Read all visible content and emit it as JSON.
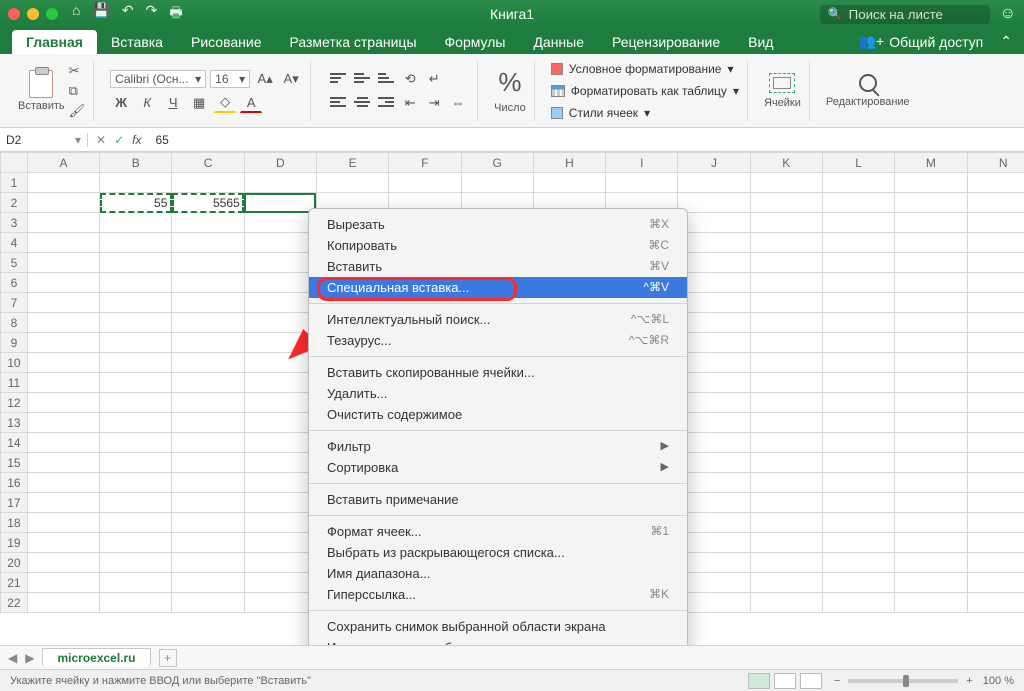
{
  "title": "Книга1",
  "search_placeholder": "Поиск на листе",
  "tabs": {
    "home": "Главная",
    "insert": "Вставка",
    "draw": "Рисование",
    "layout": "Разметка страницы",
    "formulas": "Формулы",
    "data": "Данные",
    "review": "Рецензирование",
    "view": "Вид",
    "share": "Общий доступ"
  },
  "ribbon": {
    "paste": "Вставить",
    "font_name": "Calibri (Осн...",
    "font_size": "16",
    "number": "Число",
    "cond_fmt": "Условное форматирование",
    "fmt_table": "Форматировать как таблицу",
    "cell_styles": "Стили ячеек",
    "cells": "Ячейки",
    "editing": "Редактирование"
  },
  "namebox": "D2",
  "formula": "65",
  "columns": [
    "A",
    "B",
    "C",
    "D",
    "E",
    "F",
    "G",
    "H",
    "I",
    "J",
    "K",
    "L",
    "M",
    "N"
  ],
  "rows": 22,
  "cells": {
    "B2": "55",
    "C2": "5565"
  },
  "context_menu": {
    "cut": {
      "label": "Вырезать",
      "sc": "⌘X"
    },
    "copy": {
      "label": "Копировать",
      "sc": "⌘C"
    },
    "paste": {
      "label": "Вставить",
      "sc": "⌘V"
    },
    "paste_special": {
      "label": "Специальная вставка...",
      "sc": "^⌘V"
    },
    "smart_lookup": {
      "label": "Интеллектуальный поиск...",
      "sc": "^⌥⌘L"
    },
    "thesaurus": {
      "label": "Тезаурус...",
      "sc": "^⌥⌘R"
    },
    "insert_copied": {
      "label": "Вставить скопированные ячейки..."
    },
    "delete": {
      "label": "Удалить..."
    },
    "clear": {
      "label": "Очистить содержимое"
    },
    "filter": {
      "label": "Фильтр"
    },
    "sort": {
      "label": "Сортировка"
    },
    "insert_comment": {
      "label": "Вставить примечание"
    },
    "format_cells": {
      "label": "Формат ячеек...",
      "sc": "⌘1"
    },
    "dropdown": {
      "label": "Выбрать из раскрывающегося списка..."
    },
    "range_name": {
      "label": "Имя диапазона..."
    },
    "hyperlink": {
      "label": "Гиперссылка...",
      "sc": "⌘K"
    },
    "save_snap": {
      "label": "Сохранить снимок выбранной области экрана"
    },
    "import_img": {
      "label": "Импортировать изображение"
    }
  },
  "sheet_tab": "microexcel.ru",
  "status_text": "Укажите ячейку и нажмите ВВОД или выберите \"Вставить\"",
  "zoom": "100 %"
}
